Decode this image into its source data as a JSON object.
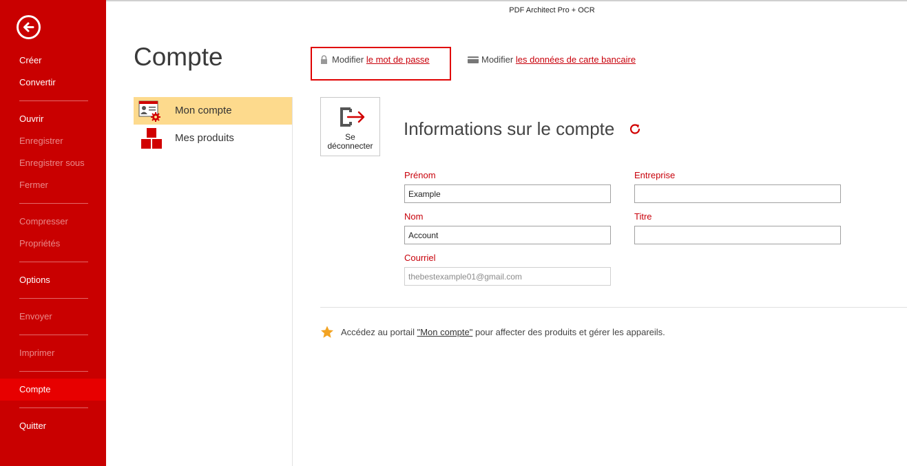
{
  "window": {
    "title": "PDF Architect Pro + OCR"
  },
  "sidebar": {
    "items": [
      {
        "label": "Créer",
        "state": "enabled"
      },
      {
        "label": "Convertir",
        "state": "enabled"
      },
      {
        "label": "Ouvrir",
        "state": "enabled"
      },
      {
        "label": "Enregistrer",
        "state": "disabled"
      },
      {
        "label": "Enregistrer sous",
        "state": "disabled"
      },
      {
        "label": "Fermer",
        "state": "disabled"
      },
      {
        "label": "Compresser",
        "state": "disabled"
      },
      {
        "label": "Propriétés",
        "state": "disabled"
      },
      {
        "label": "Options",
        "state": "enabled"
      },
      {
        "label": "Envoyer",
        "state": "disabled"
      },
      {
        "label": "Imprimer",
        "state": "disabled"
      },
      {
        "label": "Compte",
        "state": "active"
      },
      {
        "label": "Quitter",
        "state": "enabled"
      }
    ]
  },
  "page": {
    "title": "Compte"
  },
  "nav": {
    "items": [
      {
        "label": "Mon compte",
        "selected": true
      },
      {
        "label": "Mes produits",
        "selected": false
      }
    ]
  },
  "links": {
    "password": {
      "prefix": "Modifier",
      "link": "le mot de passe"
    },
    "card": {
      "prefix": "Modifier",
      "link": "les données de carte bancaire"
    }
  },
  "logout": {
    "line1": "Se",
    "line2": "déconnecter"
  },
  "account": {
    "title": "Informations sur le compte",
    "fields": {
      "first_name": {
        "label": "Prénom",
        "value": "Example"
      },
      "company": {
        "label": "Entreprise",
        "value": ""
      },
      "last_name": {
        "label": "Nom",
        "value": "Account"
      },
      "job_title": {
        "label": "Titre",
        "value": ""
      },
      "email": {
        "label": "Courriel",
        "value": "thebestexample01@gmail.com"
      }
    }
  },
  "portal": {
    "prefix": "Accédez au portail",
    "link": "\"Mon compte\"",
    "suffix": "pour affecter des produits et gérer les appareils."
  },
  "colors": {
    "accent": "#c90000",
    "active": "#e70000",
    "selection": "#fdda8d",
    "link": "#c8000a"
  }
}
